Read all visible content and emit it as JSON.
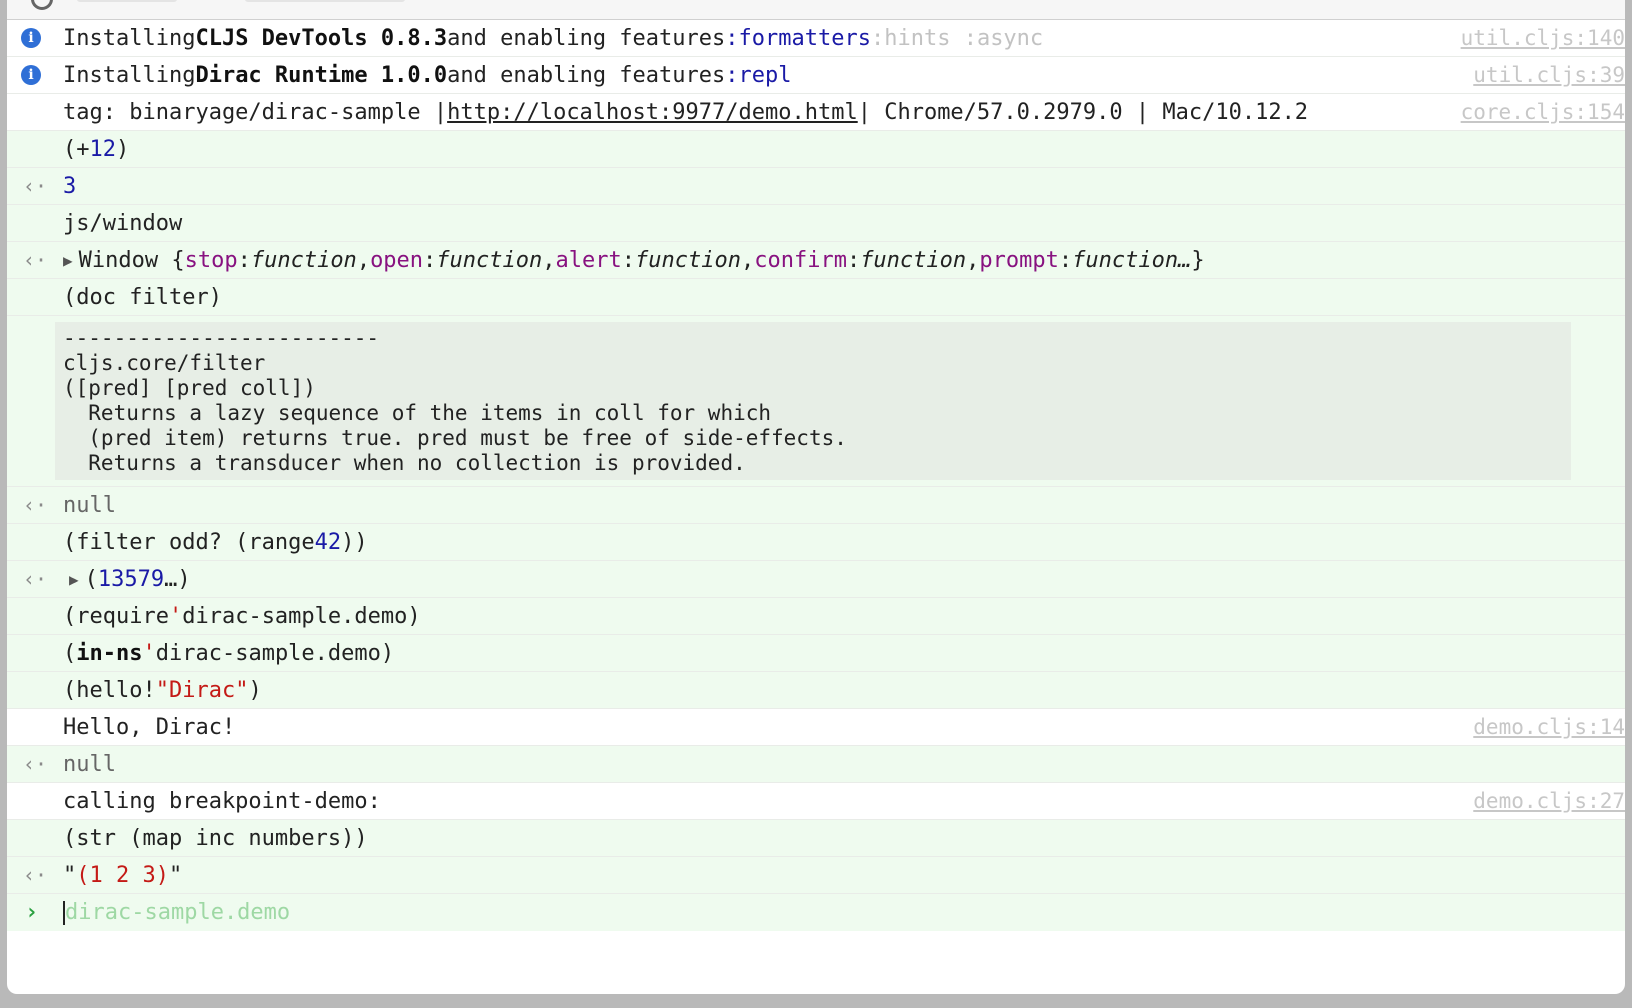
{
  "colors": {
    "info": "#2f6fd6",
    "keyword": "#1a1aa6",
    "muted_keyword": "#c2c2c2",
    "prop": "#881280",
    "string": "#c41a16",
    "result_bg": "#effbef",
    "prompt": "#2aa040"
  },
  "icons": {
    "info": "info-icon",
    "result": "result-arrow-icon",
    "prompt": "prompt-chevron-icon",
    "expand": "expand-triangle-icon"
  },
  "logs": {
    "devtools": {
      "pre": "Installing ",
      "name": "CLJS DevTools 0.8.3",
      "mid": " and enabling features ",
      "f1": ":formatters",
      "f2": " :hints :async",
      "src": "util.cljs:140"
    },
    "dirac": {
      "pre": "Installing ",
      "name": "Dirac Runtime 1.0.0",
      "mid": " and enabling features ",
      "f1": ":repl",
      "src": "util.cljs:39"
    },
    "tag": {
      "pre": "tag: binaryage/dirac-sample | ",
      "url": "http://localhost:9977/demo.html",
      "post": " | Chrome/57.0.2979.0 | Mac/10.12.2",
      "src": "core.cljs:154"
    },
    "hello": {
      "text": "Hello, Dirac!",
      "src": "demo.cljs:14"
    },
    "calling": {
      "text": "calling breakpoint-demo:",
      "src": "demo.cljs:27"
    }
  },
  "repl": {
    "plus": {
      "open": "(+ ",
      "a": "1",
      "sp": " ",
      "b": "2",
      "close": ")"
    },
    "plus_result": "3",
    "window_expr": "js/window",
    "window_result": {
      "label": "Window {",
      "props": [
        {
          "k": "stop",
          "v": "function"
        },
        {
          "k": "open",
          "v": "function"
        },
        {
          "k": "alert",
          "v": "function"
        },
        {
          "k": "confirm",
          "v": "function"
        },
        {
          "k": "prompt",
          "v": "function…"
        }
      ],
      "close": "}"
    },
    "doc_expr": "(doc filter)",
    "doc_text": "-------------------------\ncljs.core/filter\n([pred] [pred coll])\n  Returns a lazy sequence of the items in coll for which\n  (pred item) returns true. pred must be free of side-effects.\n  Returns a transducer when no collection is provided.",
    "doc_result": "null",
    "filter_expr": {
      "pre": "(filter odd? (range ",
      "n": "42",
      "post": "))"
    },
    "filter_result": {
      "open": "(",
      "items": [
        "1",
        "3",
        "5",
        "7",
        "9"
      ],
      "ell": " …",
      "close": ")"
    },
    "require_expr": {
      "pre": "(require ",
      "q": "'",
      "ns": "dirac-sample.demo",
      "close": ")"
    },
    "inns_expr": {
      "open": "(",
      "kw": "in-ns",
      "sp": " ",
      "q": "'",
      "ns": "dirac-sample.demo",
      "close": ")"
    },
    "hello_expr": {
      "pre": "(hello! ",
      "str": "\"Dirac\"",
      "close": ")"
    },
    "hello_result": "null",
    "str_expr": "(str (map inc numbers))",
    "str_result": {
      "q1": "\"",
      "inner": "(1 2 3)",
      "q2": "\""
    }
  },
  "prompt": {
    "placeholder": "dirac-sample.demo"
  }
}
